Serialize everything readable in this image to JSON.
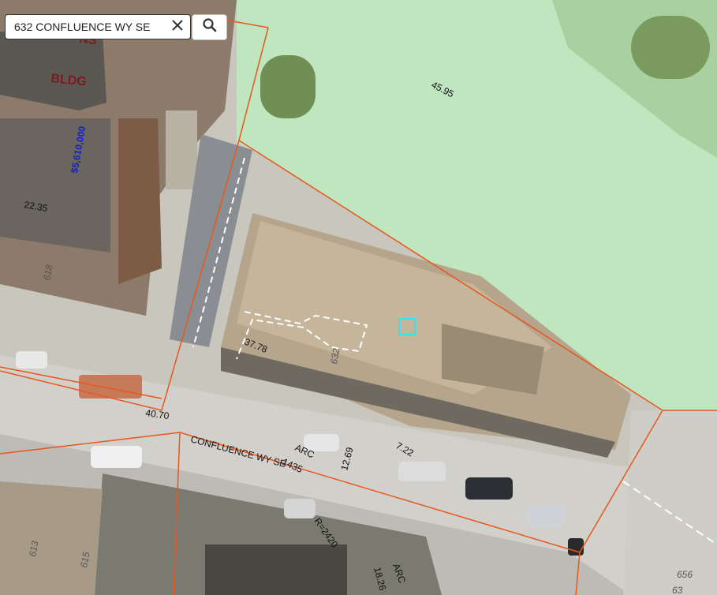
{
  "search": {
    "value": "632 CONFLUENCE WY SE"
  },
  "map": {
    "street_name": "CONFLUENCE WY SE",
    "building_label": "BLDG",
    "building_label_partial": "NS",
    "property_value": "$5,610,000",
    "address_numbers": [
      "632",
      "618",
      "613",
      "615",
      "656",
      "63"
    ],
    "dimensions": [
      "45.95",
      "37.78",
      "40.70",
      "22.35",
      "12.69",
      "7.22",
      "1435",
      "18.26"
    ],
    "arc_labels": [
      "ARC",
      "ARC"
    ],
    "radius_label": "R=2420",
    "colors": {
      "parcel_line": "#e8571e",
      "park_tint": "#bfe6bf",
      "selection": "#2ee6f0",
      "value_label": "#1520c8"
    }
  }
}
